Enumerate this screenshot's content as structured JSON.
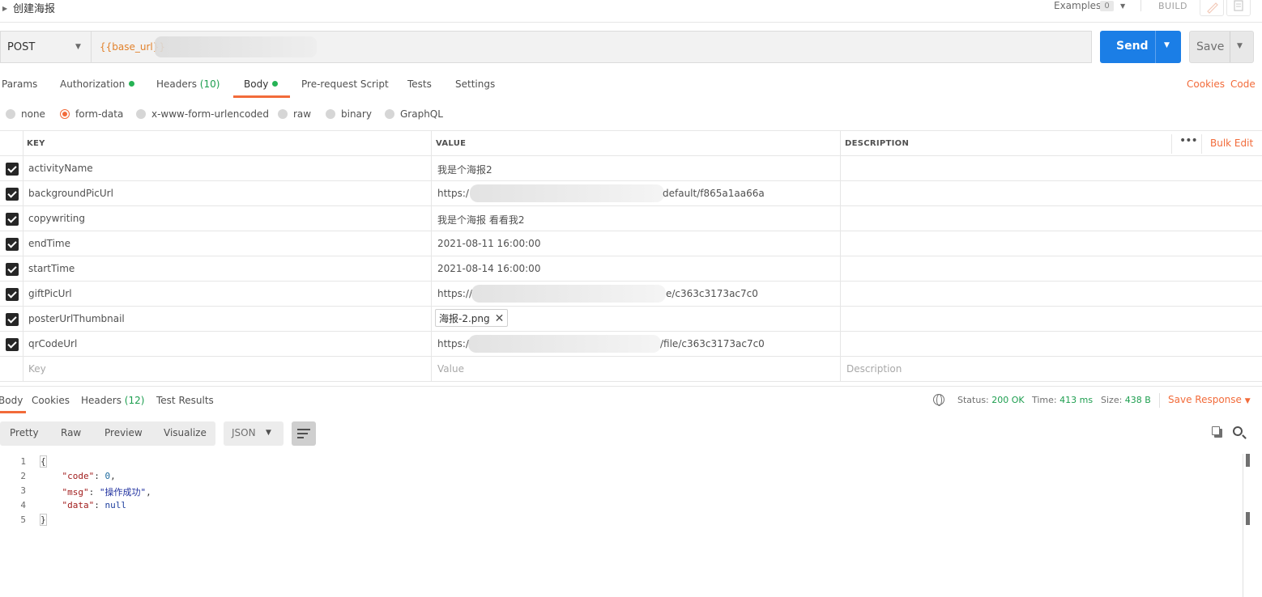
{
  "request": {
    "title": "创建海报",
    "examples_label": "Examples",
    "examples_count": "0",
    "build_label": "BUILD",
    "method": "POST",
    "url": "{{base_url}}",
    "send_label": "Send",
    "save_label": "Save"
  },
  "req_tabs": [
    {
      "label": "Params"
    },
    {
      "label": "Authorization"
    },
    {
      "label": "Headers",
      "count": "(10)"
    },
    {
      "label": "Body"
    },
    {
      "label": "Pre-request Script"
    },
    {
      "label": "Tests"
    },
    {
      "label": "Settings"
    }
  ],
  "links": {
    "cookies": "Cookies",
    "code": "Code"
  },
  "body_types": [
    "none",
    "form-data",
    "x-www-form-urlencoded",
    "raw",
    "binary",
    "GraphQL"
  ],
  "body_type_selected": "form-data",
  "table": {
    "headers": {
      "key": "KEY",
      "value": "VALUE",
      "description": "DESCRIPTION"
    },
    "bulk_edit": "Bulk Edit",
    "rows": [
      {
        "key": "activityName",
        "value": "我是个海报2"
      },
      {
        "key": "backgroundPicUrl",
        "value_prefix": "https:/",
        "value_suffix": "default/f865a1aa66a"
      },
      {
        "key": "copywriting",
        "value": "我是个海报  看看我2"
      },
      {
        "key": "endTime",
        "value": "2021-08-11 16:00:00"
      },
      {
        "key": "startTime",
        "value": "2021-08-14 16:00:00"
      },
      {
        "key": "giftPicUrl",
        "value_prefix": "https://",
        "value_suffix": "e/c363c3173ac7c0"
      },
      {
        "key": "posterUrlThumbnail",
        "file": "海报-2.png"
      },
      {
        "key": "qrCodeUrl",
        "value_prefix": "https:/",
        "value_suffix": "/file/c363c3173ac7c0"
      }
    ],
    "placeholder": {
      "key": "Key",
      "value": "Value",
      "description": "Description"
    }
  },
  "response": {
    "tabs": [
      {
        "label": "Body"
      },
      {
        "label": "Cookies"
      },
      {
        "label": "Headers",
        "count": "(12)"
      },
      {
        "label": "Test Results"
      }
    ],
    "status_label": "Status:",
    "status_value": "200 OK",
    "time_label": "Time:",
    "time_value": "413 ms",
    "size_label": "Size:",
    "size_value": "438 B",
    "save_response": "Save Response",
    "view_modes": [
      "Pretty",
      "Raw",
      "Preview",
      "Visualize"
    ],
    "format": "JSON",
    "code_lines": [
      {
        "n": "1"
      },
      {
        "n": "2",
        "key": "\"code\"",
        "val": "0"
      },
      {
        "n": "3",
        "key": "\"msg\"",
        "val": "\"操作成功\""
      },
      {
        "n": "4",
        "key": "\"data\"",
        "val": "null"
      },
      {
        "n": "5"
      }
    ]
  },
  "colors": {
    "accent": "#f26b3a",
    "send": "#1b7ee6",
    "success": "#1d9e4f"
  }
}
